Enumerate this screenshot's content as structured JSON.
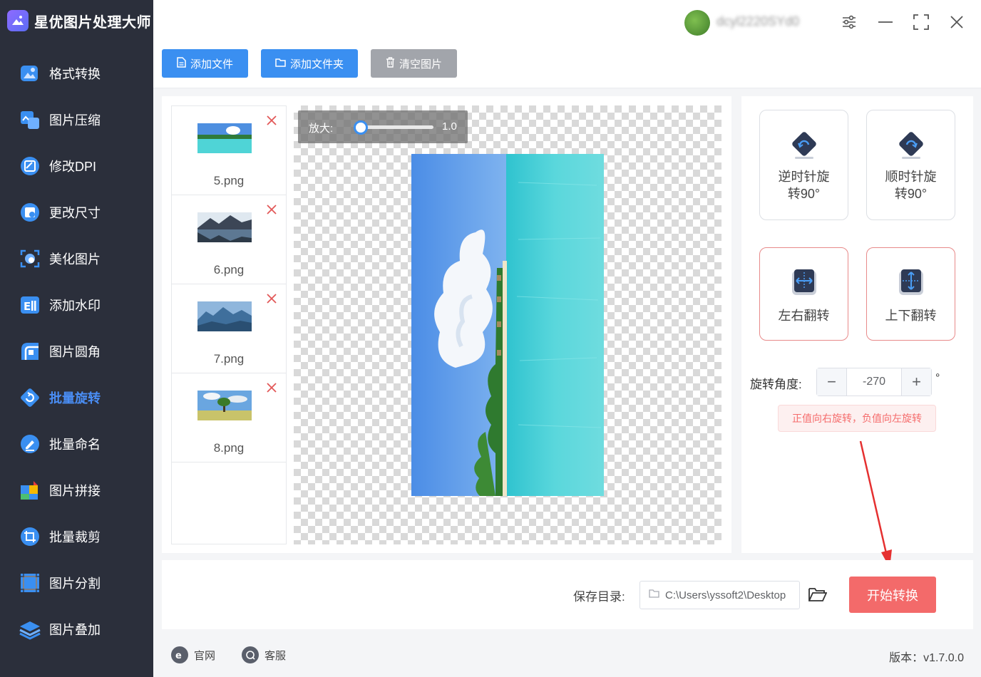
{
  "app": {
    "title": "星优图片处理大师",
    "username": "dcyl2220SYd0"
  },
  "sidebar": {
    "items": [
      {
        "label": "格式转换",
        "icon": "image-convert-icon"
      },
      {
        "label": "图片压缩",
        "icon": "image-compress-icon"
      },
      {
        "label": "修改DPI",
        "icon": "dpi-icon"
      },
      {
        "label": "更改尺寸",
        "icon": "resize-icon"
      },
      {
        "label": "美化图片",
        "icon": "beautify-icon"
      },
      {
        "label": "添加水印",
        "icon": "watermark-icon"
      },
      {
        "label": "图片圆角",
        "icon": "rounded-corner-icon"
      },
      {
        "label": "批量旋转",
        "icon": "rotate-icon",
        "active": true
      },
      {
        "label": "批量命名",
        "icon": "rename-icon"
      },
      {
        "label": "图片拼接",
        "icon": "puzzle-icon"
      },
      {
        "label": "批量裁剪",
        "icon": "crop-icon"
      },
      {
        "label": "图片分割",
        "icon": "split-icon"
      },
      {
        "label": "图片叠加",
        "icon": "layers-icon"
      }
    ]
  },
  "toolbar": {
    "add_file": "添加文件",
    "add_folder": "添加文件夹",
    "clear": "清空图片"
  },
  "files": [
    {
      "name": "5.png"
    },
    {
      "name": "6.png"
    },
    {
      "name": "7.png"
    },
    {
      "name": "8.png"
    }
  ],
  "zoom": {
    "label": "放大:",
    "value": "1.0",
    "fraction": 0.0
  },
  "options": {
    "ccw": "逆时针旋转90°",
    "ccw_line1": "逆时针旋",
    "ccw_line2": "转90°",
    "cw": "顺时针旋转90°",
    "cw_line1": "顺时针旋",
    "cw_line2": "转90°",
    "flip_h": "左右翻转",
    "flip_v": "上下翻转"
  },
  "rotation": {
    "label": "旋转角度:",
    "value": "-270",
    "minus": "−",
    "plus": "+",
    "unit": "°",
    "hint": "正值向右旋转，负值向左旋转"
  },
  "save": {
    "label": "保存目录:",
    "path": "C:\\Users\\yssoft2\\Desktop",
    "start": "开始转换"
  },
  "footer": {
    "website": "官网",
    "support": "客服",
    "version": "版本：v1.7.0.0"
  },
  "colors": {
    "accent": "#3a8ff1",
    "danger": "#f36a6a",
    "sidebar": "#2b2f3b"
  }
}
